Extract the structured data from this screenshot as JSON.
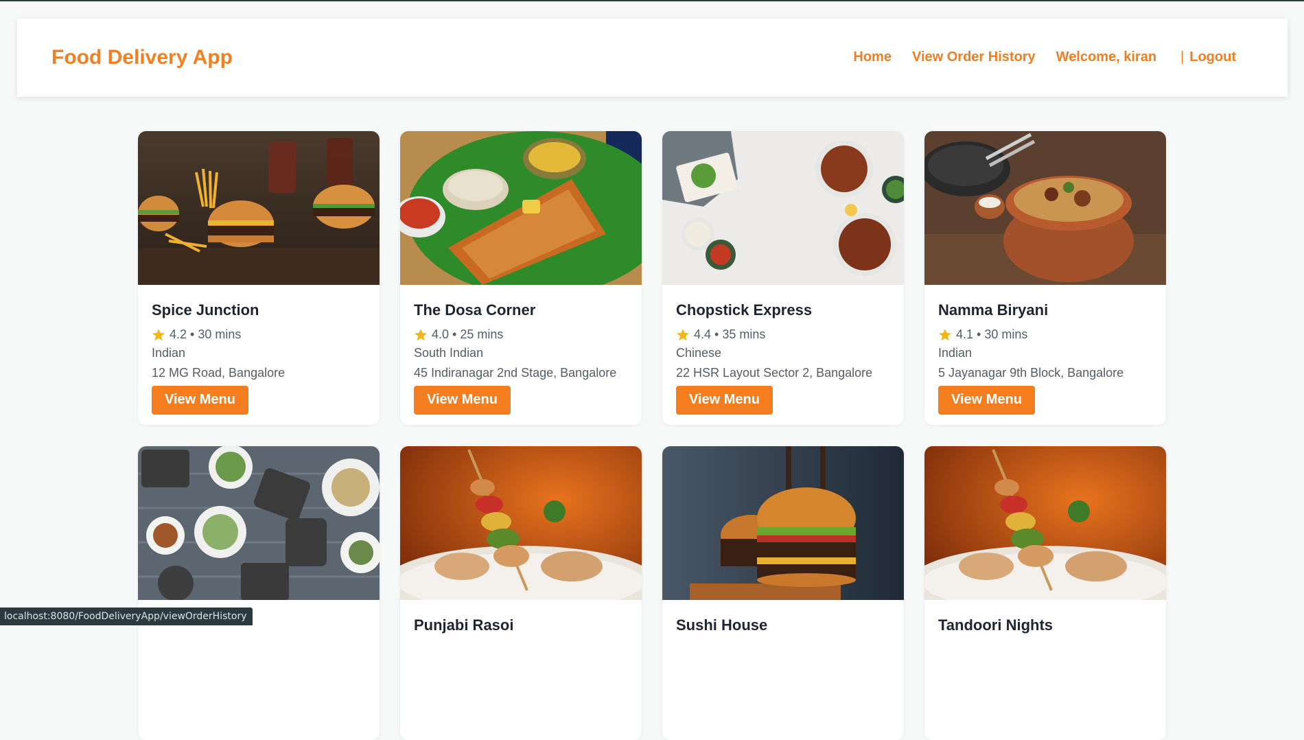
{
  "header": {
    "brand": "Food Delivery App",
    "nav": {
      "home": "Home",
      "order_history": "View Order History",
      "welcome_prefix": "Welcome,",
      "username": "kiran",
      "separator": "|",
      "logout": "Logout"
    }
  },
  "restaurants": [
    {
      "name": "Spice Junction",
      "rating": "4.2",
      "time": "30 mins",
      "cuisine": "Indian",
      "address": "12 MG Road, Bangalore",
      "button": "View Menu",
      "image": "burgers-fries-icon"
    },
    {
      "name": "The Dosa Corner",
      "rating": "4.0",
      "time": "25 mins",
      "cuisine": "South Indian",
      "address": "45 Indiranagar 2nd Stage, Bangalore",
      "button": "View Menu",
      "image": "dosa-icon"
    },
    {
      "name": "Chopstick Express",
      "rating": "4.4",
      "time": "35 mins",
      "cuisine": "Chinese",
      "address": "22 HSR Layout Sector 2, Bangalore",
      "button": "View Menu",
      "image": "chinese-dishes-icon"
    },
    {
      "name": "Namma Biryani",
      "rating": "4.1",
      "time": "30 mins",
      "cuisine": "Indian",
      "address": "5 Jayanagar 9th Block, Bangalore",
      "button": "View Menu",
      "image": "biryani-pot-icon"
    },
    {
      "name": "",
      "rating": "",
      "time": "",
      "cuisine": "",
      "address": "",
      "button": "",
      "image": "food-platter-icon"
    },
    {
      "name": "Punjabi Rasoi",
      "rating": "",
      "time": "",
      "cuisine": "",
      "address": "",
      "button": "",
      "image": "skewer-icon"
    },
    {
      "name": "Sushi House",
      "rating": "",
      "time": "",
      "cuisine": "",
      "address": "",
      "button": "",
      "image": "burger-icon"
    },
    {
      "name": "Tandoori Nights",
      "rating": "",
      "time": "",
      "cuisine": "",
      "address": "",
      "button": "",
      "image": "skewer-icon"
    }
  ],
  "status_bar": {
    "url": "localhost:8080/FoodDeliveryApp/viewOrderHistory"
  },
  "colors": {
    "accent": "#f47d1f",
    "star": "#f2b619",
    "text_dark": "#1e2430",
    "text_muted": "#555c66"
  }
}
